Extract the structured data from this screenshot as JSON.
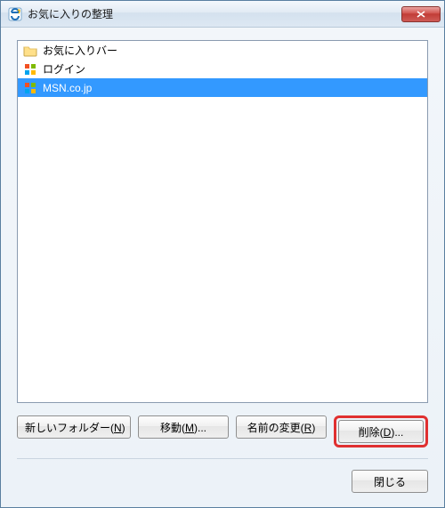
{
  "title": "お気に入りの整理",
  "items": [
    {
      "label": "お気に入りバー",
      "icon": "folder-icon",
      "selected": false
    },
    {
      "label": "ログイン",
      "icon": "ms-tiles-icon",
      "selected": false
    },
    {
      "label": "MSN.co.jp",
      "icon": "ms-tiles-icon",
      "selected": true
    }
  ],
  "buttons": {
    "new_folder": {
      "prefix": "新しいフォルダー(",
      "ul": "N",
      "suffix": ")"
    },
    "move": {
      "prefix": "移動(",
      "ul": "M",
      "suffix": ")..."
    },
    "rename": {
      "prefix": "名前の変更(",
      "ul": "R",
      "suffix": ")"
    },
    "delete": {
      "prefix": "削除(",
      "ul": "D",
      "suffix": ")..."
    },
    "close": {
      "label": "閉じる"
    }
  },
  "colors": {
    "selection": "#3399ff",
    "highlight_border": "#e03030"
  }
}
